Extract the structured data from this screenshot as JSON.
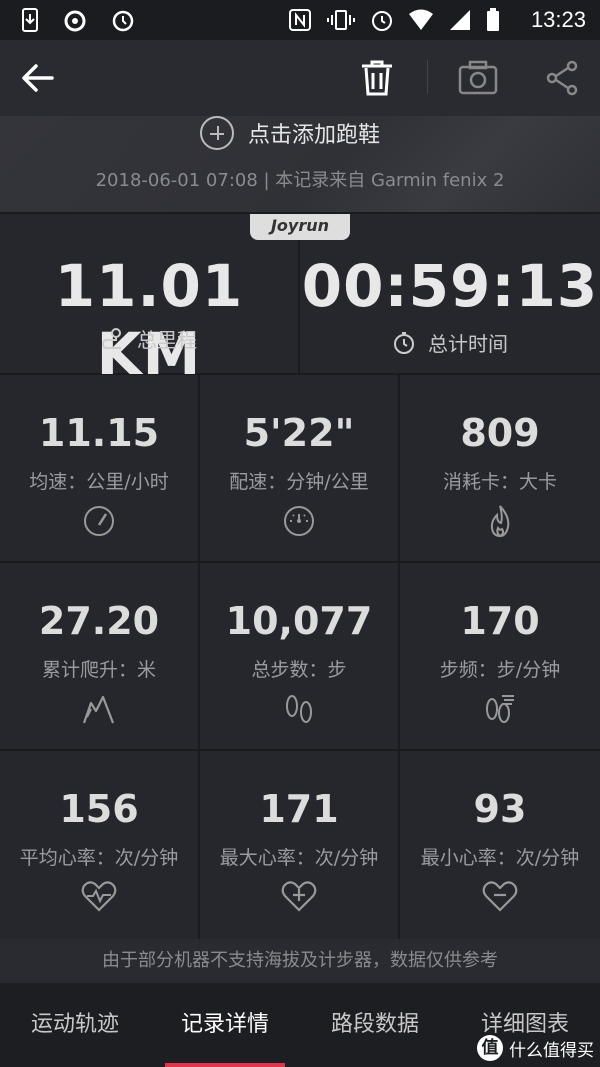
{
  "status_bar": {
    "time": "13:23"
  },
  "top_bar": {
    "icons": [
      "back-arrow-icon",
      "trash-icon",
      "camera-icon",
      "share-icon"
    ]
  },
  "header": {
    "add_shoe": "点击添加跑鞋",
    "record_meta": "2018-06-01 07:08 | 本记录来自 Garmin fenix 2"
  },
  "brand": "Joyrun",
  "summary": {
    "distance": {
      "value": "11.01 KM",
      "label": "总里程",
      "icon": "route-icon"
    },
    "duration": {
      "value": "00:59:13",
      "label": "总计时间",
      "icon": "stopwatch-icon"
    }
  },
  "stats": [
    {
      "value": "11.15",
      "label": "均速：公里/小时",
      "icon": "speedometer-icon"
    },
    {
      "value": "5'22\"",
      "label": "配速：分钟/公里",
      "icon": "gauge-icon"
    },
    {
      "value": "809",
      "label": "消耗卡：大卡",
      "icon": "flame-icon"
    },
    {
      "value": "27.20",
      "label": "累计爬升：米",
      "icon": "mountain-icon"
    },
    {
      "value": "10,077",
      "label": "总步数：步",
      "icon": "footprints-icon"
    },
    {
      "value": "170",
      "label": "步频：步/分钟",
      "icon": "cadence-icon"
    },
    {
      "value": "156",
      "label": "平均心率：次/分钟",
      "icon": "heart-pulse-icon"
    },
    {
      "value": "171",
      "label": "最大心率：次/分钟",
      "icon": "heart-plus-icon"
    },
    {
      "value": "93",
      "label": "最小心率：次/分钟",
      "icon": "heart-minus-icon"
    }
  ],
  "disclaimer": "由于部分机器不支持海拔及计步器，数据仅供参考",
  "tabs": [
    {
      "label": "运动轨迹",
      "active": false
    },
    {
      "label": "记录详情",
      "active": true
    },
    {
      "label": "路段数据",
      "active": false
    },
    {
      "label": "详细图表",
      "active": false
    }
  ],
  "watermark": {
    "logo": "值",
    "text": "什么值得买"
  },
  "colors": {
    "accent": "#e0354a",
    "background": "#24252a"
  }
}
